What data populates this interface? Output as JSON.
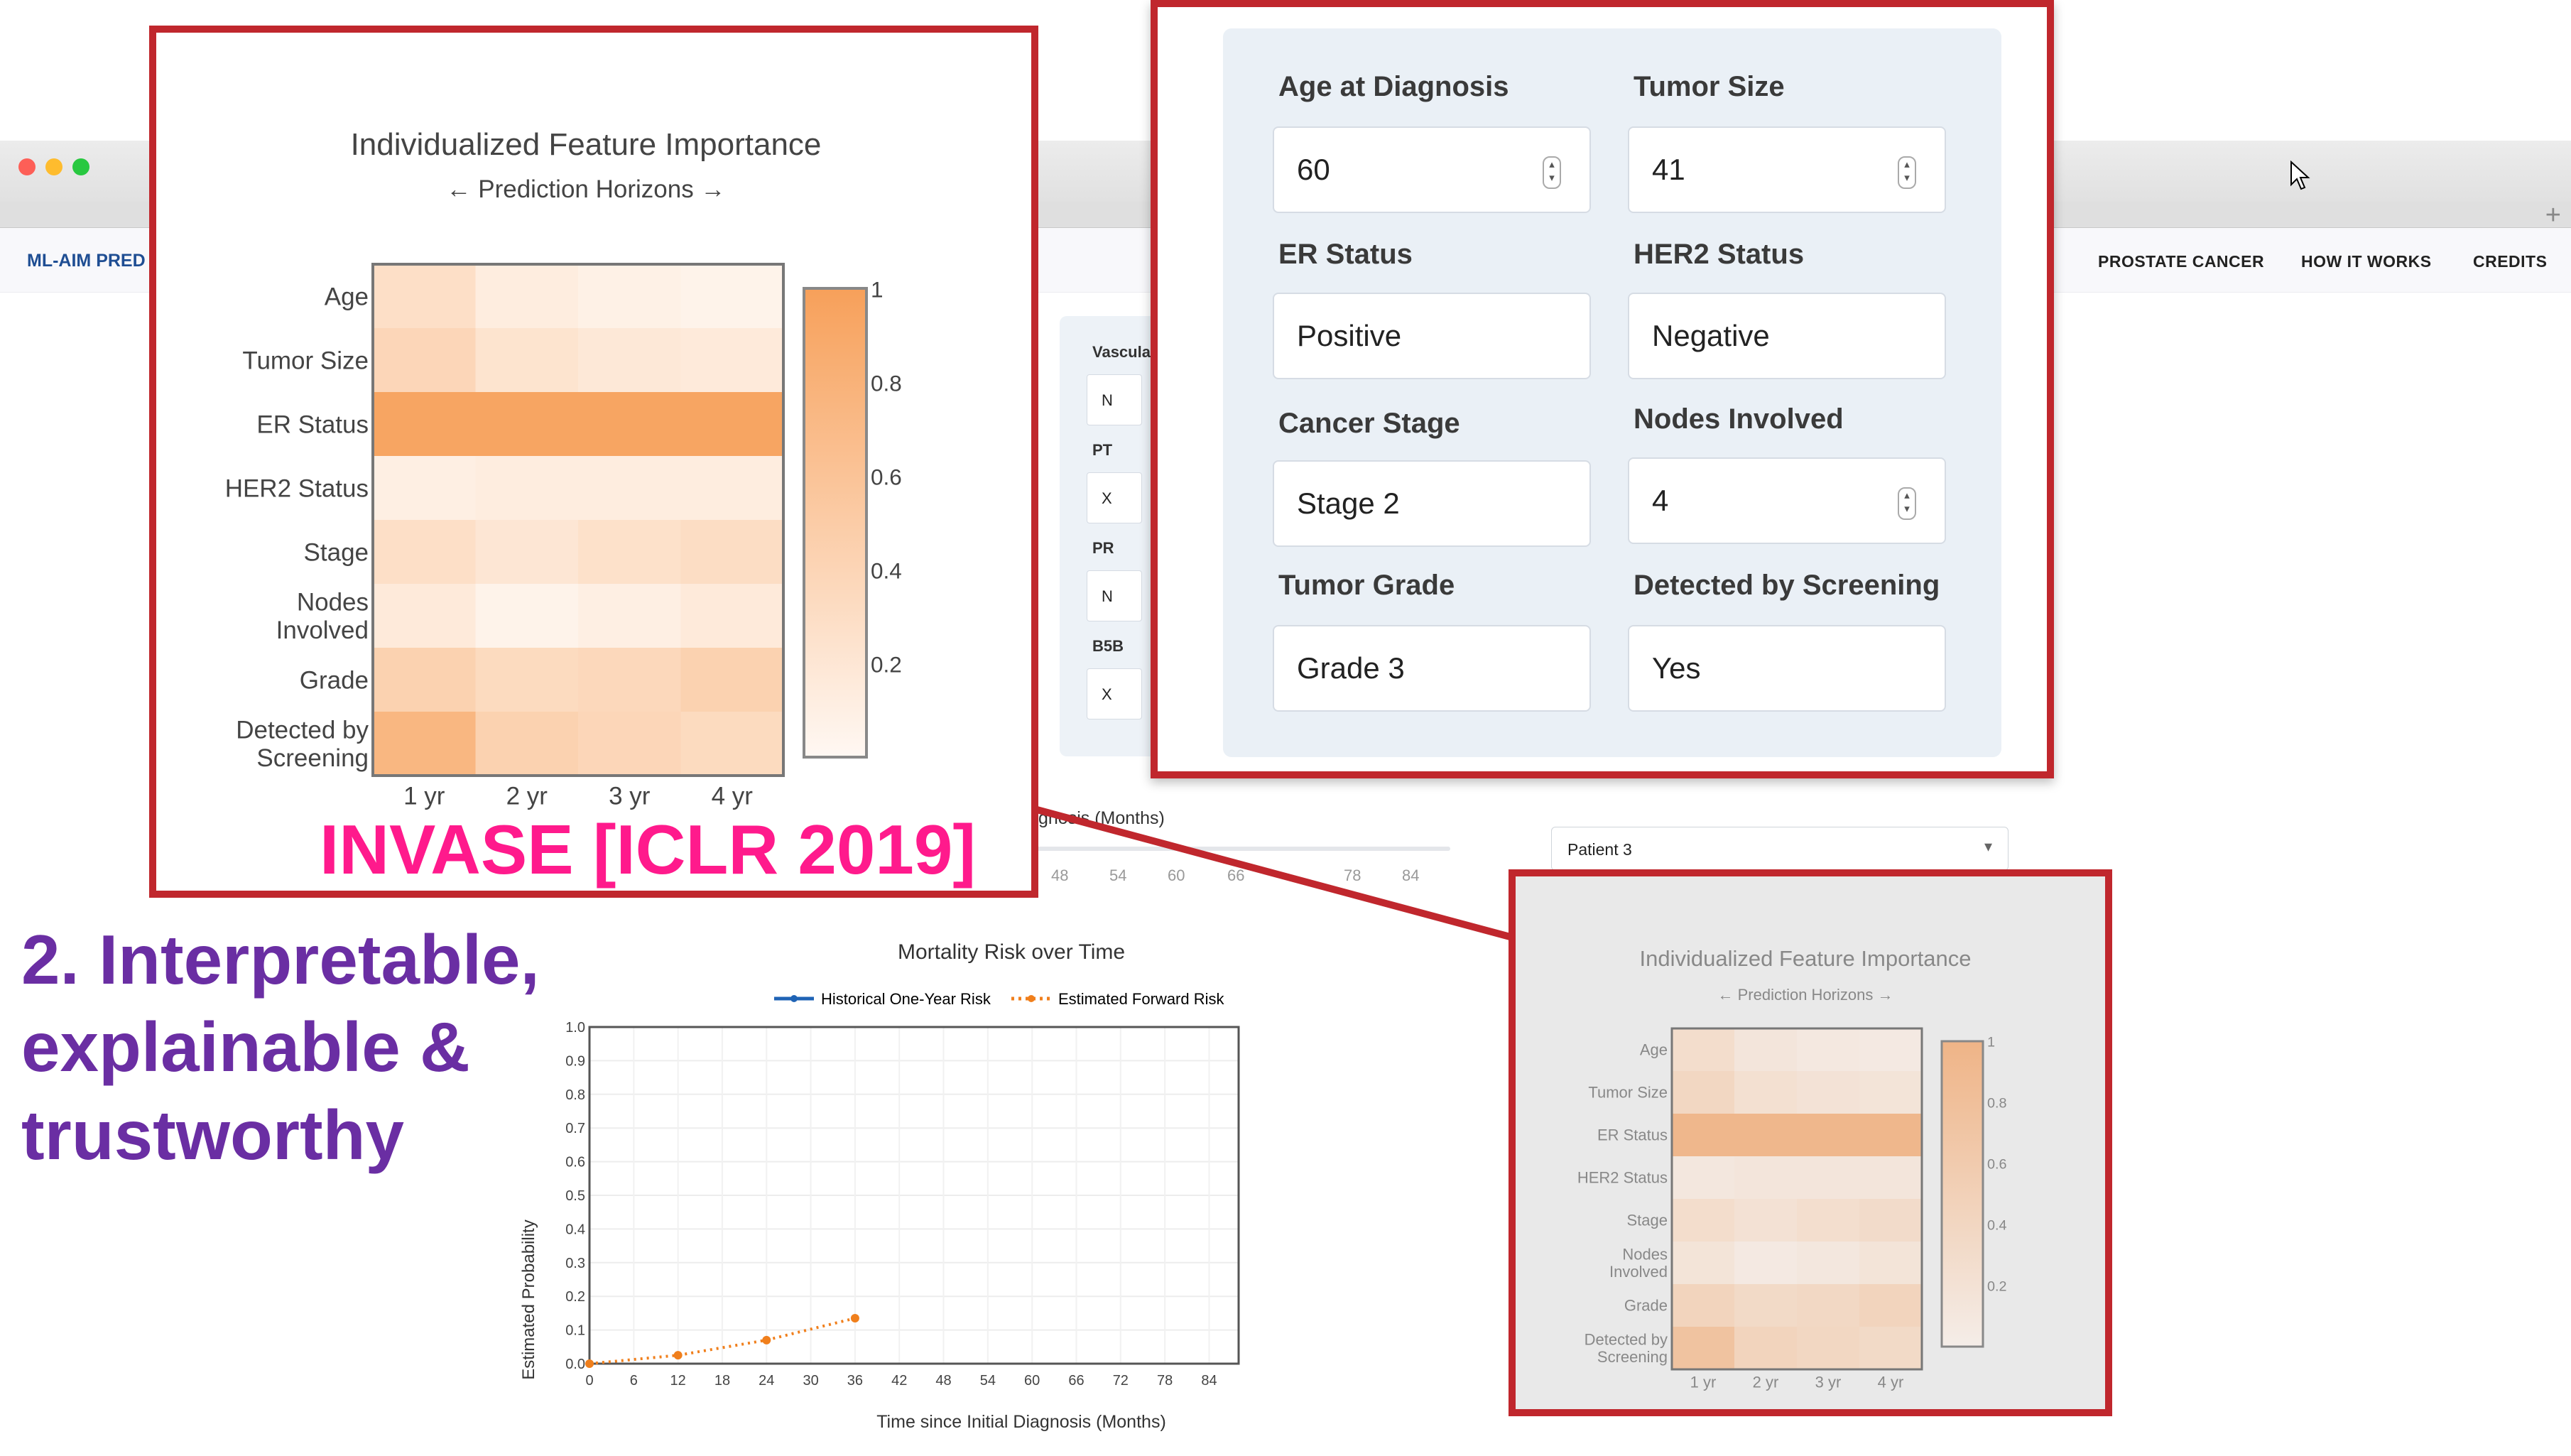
{
  "nav": {
    "brand": "ML-AIM PRED",
    "links": [
      "PROSTATE CANCER",
      "HOW IT WORKS",
      "CREDITS"
    ]
  },
  "side_panel": {
    "items": [
      {
        "label": "Vascula",
        "value": "N"
      },
      {
        "label": "PT",
        "value": "X"
      },
      {
        "label": "PR",
        "value": "N"
      },
      {
        "label": "B5B",
        "value": "X"
      }
    ]
  },
  "slider": {
    "label": "gnosis (Months)",
    "ticks": [
      "48",
      "54",
      "60",
      "66",
      "",
      "78",
      "84"
    ]
  },
  "patient_select": {
    "value": "Patient 3"
  },
  "overlay": {
    "invase": "INVASE [ICLR 2019]",
    "headline_lines": [
      "2. Interpretable,",
      "explainable &",
      "trustworthy"
    ]
  },
  "form": {
    "fields": [
      {
        "label": "Age at Diagnosis",
        "value": "60",
        "spinner": true
      },
      {
        "label": "Tumor Size",
        "value": "41",
        "spinner": true
      },
      {
        "label": "ER Status",
        "value": "Positive",
        "spinner": false
      },
      {
        "label": "HER2 Status",
        "value": "Negative",
        "spinner": false
      },
      {
        "label": "Cancer Stage",
        "value": "Stage 2",
        "spinner": false
      },
      {
        "label": "Nodes Involved",
        "value": "4",
        "spinner": true
      },
      {
        "label": "Tumor Grade",
        "value": "Grade 3",
        "spinner": false
      },
      {
        "label": "Detected by Screening",
        "value": "Yes",
        "spinner": false
      }
    ]
  },
  "chart_data": [
    {
      "type": "heatmap",
      "title": "Individualized Feature Importance",
      "subtitle": "← Prediction Horizons →",
      "rows": [
        "Age",
        "Tumor Size",
        "ER Status",
        "HER2 Status",
        "Stage",
        "Nodes Involved",
        "Grade",
        "Detected by Screening"
      ],
      "columns": [
        "1 yr",
        "2 yr",
        "3 yr",
        "4 yr"
      ],
      "values": [
        [
          0.3,
          0.15,
          0.1,
          0.08
        ],
        [
          0.4,
          0.25,
          0.2,
          0.18
        ],
        [
          0.95,
          0.95,
          0.95,
          0.95
        ],
        [
          0.12,
          0.15,
          0.15,
          0.15
        ],
        [
          0.3,
          0.22,
          0.28,
          0.32
        ],
        [
          0.18,
          0.08,
          0.12,
          0.18
        ],
        [
          0.45,
          0.35,
          0.38,
          0.45
        ],
        [
          0.75,
          0.45,
          0.4,
          0.35
        ]
      ],
      "colorbar": {
        "ticks": [
          "1",
          "0.8",
          "0.6",
          "0.4",
          "0.2"
        ],
        "range": [
          0,
          1
        ],
        "color": "#f7a05a"
      }
    },
    {
      "type": "line",
      "title": "Mortality Risk over Time",
      "xlabel": "Time since Initial Diagnosis (Months)",
      "ylabel": "Estimated Probability",
      "xlim": [
        0,
        88
      ],
      "ylim": [
        0,
        1.0
      ],
      "xticks": [
        0,
        6,
        12,
        18,
        24,
        30,
        36,
        42,
        48,
        54,
        60,
        66,
        72,
        78,
        84
      ],
      "yticks": [
        0.0,
        0.1,
        0.2,
        0.3,
        0.4,
        0.5,
        0.6,
        0.7,
        0.8,
        0.9,
        1.0
      ],
      "legend": "top",
      "series": [
        {
          "name": "Historical One-Year Risk",
          "color": "#1f63b5",
          "style": "solid",
          "x": [],
          "y": []
        },
        {
          "name": "Estimated Forward Risk",
          "color": "#f07f1c",
          "style": "dotted",
          "x": [
            0,
            12,
            24,
            36
          ],
          "y": [
            0.0,
            0.025,
            0.07,
            0.135
          ]
        }
      ]
    },
    {
      "type": "heatmap",
      "title": "Individualized Feature Importance",
      "subtitle": "← Prediction Horizons →",
      "rows": [
        "Age",
        "Tumor Size",
        "ER Status",
        "HER2 Status",
        "Stage",
        "Nodes Involved",
        "Grade",
        "Detected by Screening"
      ],
      "columns": [
        "1 yr",
        "2 yr",
        "3 yr",
        "4 yr"
      ],
      "values": [
        [
          0.3,
          0.15,
          0.1,
          0.08
        ],
        [
          0.4,
          0.25,
          0.2,
          0.18
        ],
        [
          0.95,
          0.95,
          0.95,
          0.95
        ],
        [
          0.12,
          0.15,
          0.15,
          0.15
        ],
        [
          0.3,
          0.22,
          0.28,
          0.32
        ],
        [
          0.18,
          0.08,
          0.12,
          0.18
        ],
        [
          0.45,
          0.35,
          0.38,
          0.45
        ],
        [
          0.75,
          0.45,
          0.4,
          0.35
        ]
      ],
      "colorbar": {
        "ticks": [
          "1",
          "0.8",
          "0.6",
          "0.4",
          "0.2"
        ],
        "range": [
          0,
          1
        ],
        "color": "#efb487"
      }
    }
  ]
}
